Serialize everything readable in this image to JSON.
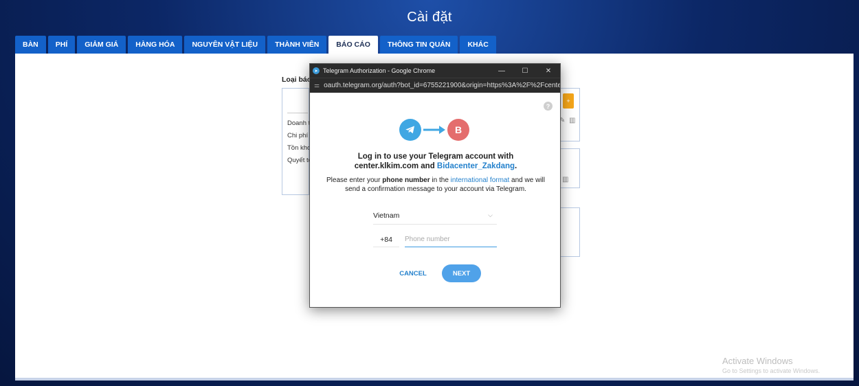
{
  "app": {
    "title": "Cài đặt"
  },
  "tabs": [
    {
      "label": "BÀN"
    },
    {
      "label": "PHÍ"
    },
    {
      "label": "GIẢM GIÁ"
    },
    {
      "label": "HÀNG HÓA"
    },
    {
      "label": "NGUYÊN VẬT LIỆU"
    },
    {
      "label": "THÀNH VIÊN"
    },
    {
      "label": "BÁO CÁO",
      "active": true
    },
    {
      "label": "THÔNG TIN QUÁN"
    },
    {
      "label": "KHÁC"
    }
  ],
  "report": {
    "label": "Loại báo",
    "items": [
      "Doanh th",
      "Chi phí",
      "Tồn kho",
      "Quyết to"
    ],
    "add_label": "+"
  },
  "popup": {
    "window_title": "Telegram Authorization - Google Chrome",
    "url": "oauth.telegram.org/auth?bot_id=6755221900&origin=https%3A%2F%2Fcente...",
    "bot_initial": "B",
    "login_line1": "Log in to use your Telegram account with",
    "login_site": "center.klkim.com and ",
    "login_bot": "Bidacenter_Zakdang",
    "login_end": ".",
    "instr_1": "Please enter your ",
    "instr_bold": "phone number",
    "instr_2": " in the ",
    "instr_link": "international format",
    "instr_3": " and we will send a confirmation message to your account via Telegram.",
    "country": "Vietnam",
    "country_code": "+84",
    "phone_placeholder": "Phone number",
    "cancel_label": "CANCEL",
    "next_label": "NEXT"
  },
  "watermark": {
    "title": "Activate Windows",
    "subtitle": "Go to Settings to activate Windows."
  }
}
